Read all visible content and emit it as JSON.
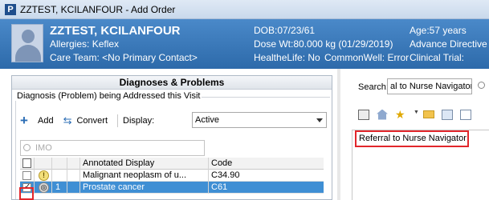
{
  "window": {
    "logo_letter": "P",
    "title": "ZZTEST, KCILANFOUR - Add Order"
  },
  "banner": {
    "patient_name": "ZZTEST, KCILANFOUR",
    "allergies": "Allergies: Keflex",
    "care_team": "Care Team: <No Primary Contact>",
    "dob": "DOB:07/23/61",
    "dose_wt": "Dose Wt:80.000 kg (01/29/2019)",
    "healthelife": "HealtheLife: No",
    "commonwell": "CommonWell: Error",
    "age": "Age:57 years",
    "advance_directive": "Advance Directive",
    "clinical_trial": "Clinical Trial:"
  },
  "diagnoses": {
    "header": "Diagnoses & Problems",
    "group_label": "Diagnosis (Problem) being Addressed this Visit",
    "add_label": "Add",
    "convert_label": "Convert",
    "display_label": "Display:",
    "display_value": "Active",
    "imo_placeholder": "IMO",
    "columns": [
      "Annotated Display",
      "Code"
    ],
    "rows": [
      {
        "checked": false,
        "num": "",
        "display": "Malignant neoplasm of u...",
        "code": "C34.90"
      },
      {
        "checked": true,
        "num": "1",
        "display": "Prostate cancer",
        "code": "C61"
      }
    ]
  },
  "orders": {
    "search_label": "Search:",
    "search_value": "al to Nurse Navigator",
    "list_item": "Referral to Nurse Navigator"
  }
}
